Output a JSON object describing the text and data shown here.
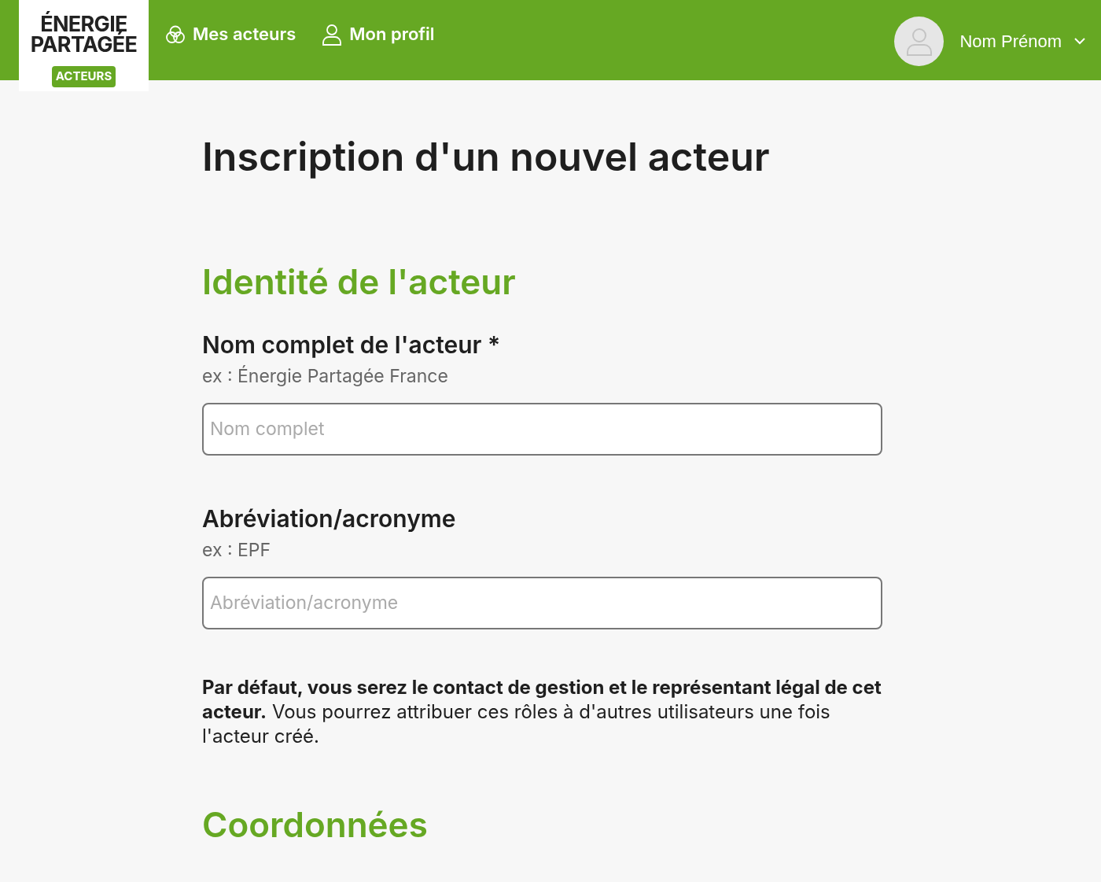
{
  "header": {
    "logo": {
      "line_1": "ÉNERGIE",
      "line_2": "PARTAGÉE",
      "badge": "ACTEURS"
    },
    "nav": [
      {
        "kind": "circles",
        "label": "Mes acteurs"
      },
      {
        "kind": "person",
        "label": "Mon profil"
      }
    ],
    "user": {
      "name": "Nom Prénom"
    }
  },
  "page_title": "Inscription d'un nouvel acteur",
  "sections": [
    {
      "title": "Identité de l'acteur",
      "fields": [
        {
          "label": "Nom complet de l'acteur *",
          "hint": "ex : Énergie Partagée France",
          "placeholder": "Nom complet"
        },
        {
          "label": "Abréviation/acronyme",
          "hint": "ex : EPF",
          "placeholder": "Abréviation/acronyme"
        }
      ],
      "note": "**Par défaut, vous serez le contact de gestion et le représentant légal de cet acteur.** Vous pourrez attribuer ces rôles à d'autres utilisateurs une fois l'acteur créé."
    },
    {
      "title": "Coordonnées"
    }
  ]
}
